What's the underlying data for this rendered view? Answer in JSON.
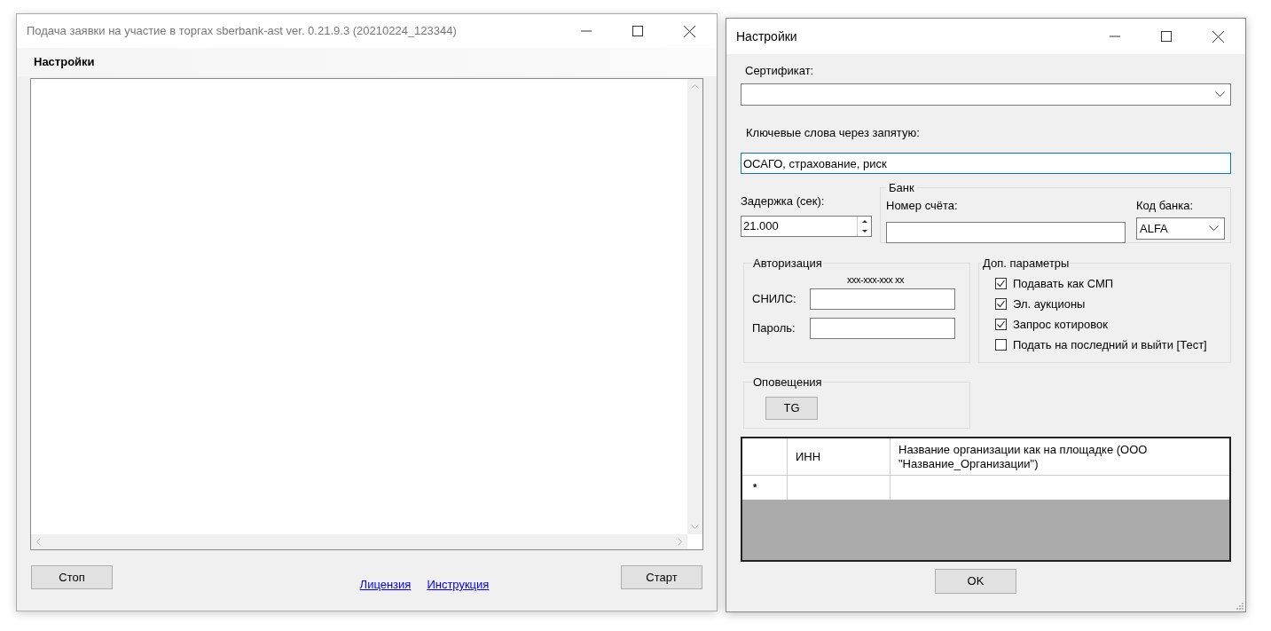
{
  "main_window": {
    "title": "Подача заявки на участие в торгах sberbank-ast ver. 0.21.9.3 (20210224_123344)",
    "menu": [
      {
        "label": "Настройки"
      }
    ],
    "buttons": {
      "stop": "Стоп",
      "start": "Старт"
    },
    "links": [
      "Лицензия",
      "Инструкция"
    ]
  },
  "settings_dialog": {
    "title": "Настройки",
    "certificate": {
      "label": "Сертификат:"
    },
    "keywords": {
      "label": "Ключевые слова через запятую:",
      "value": "ОСАГО, страхование, риск"
    },
    "delay": {
      "label": "Задержка (сек):",
      "value": "21.000"
    },
    "bank": {
      "title": "Банк",
      "account_label": "Номер счёта:",
      "code_label": "Код банка:",
      "code_value": "ALFA"
    },
    "auth": {
      "title": "Авторизация",
      "mask_hint": "xxx-xxx-xxx xx",
      "snils_label": "СНИЛС:",
      "password_label": "Пароль:"
    },
    "options": {
      "title": "Доп. параметры",
      "items": [
        {
          "label": "Подавать как СМП",
          "checked": true
        },
        {
          "label": "Эл. аукционы",
          "checked": true
        },
        {
          "label": "Запрос котировок",
          "checked": true
        },
        {
          "label": "Подать на последний и выйти [Тест]",
          "checked": false
        }
      ]
    },
    "notifications": {
      "title": "Оповещения",
      "button": "TG"
    },
    "table": {
      "columns": [
        "ИНН",
        "Название организации как на площадке (ООО \"Название_Организации\")"
      ],
      "new_row_marker": "*"
    },
    "ok": "OK"
  }
}
